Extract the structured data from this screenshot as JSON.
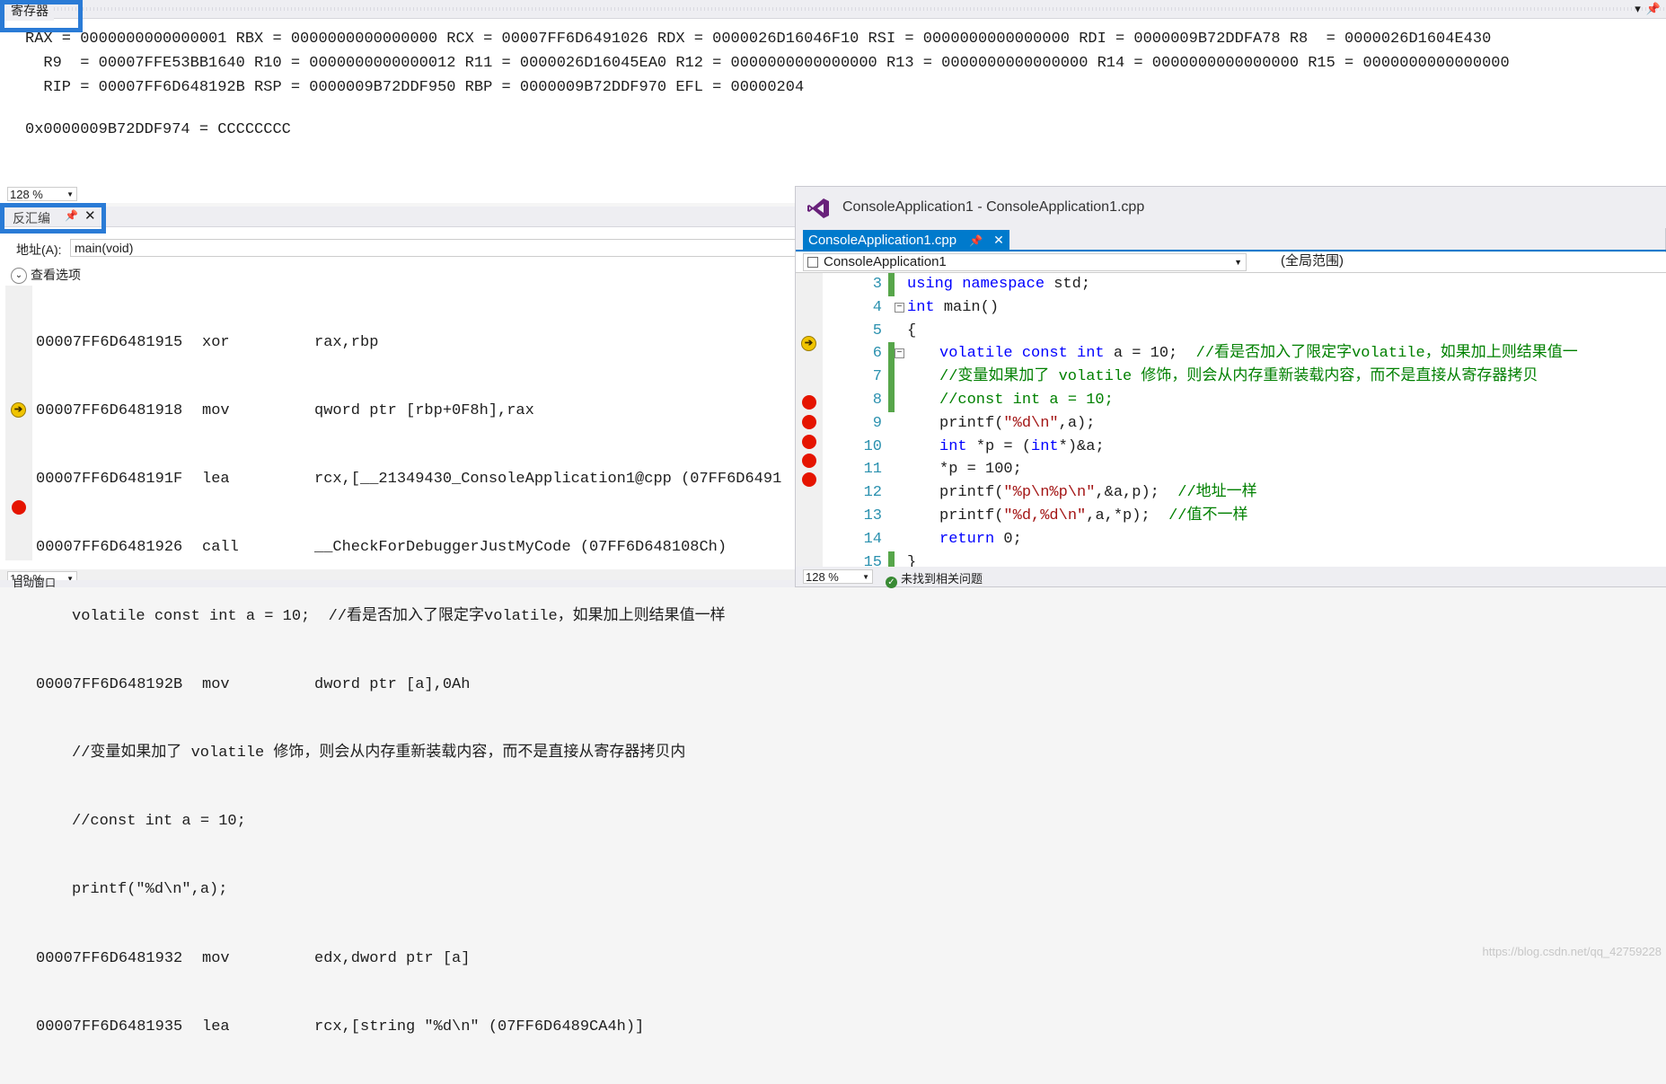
{
  "registers": {
    "title": "寄存器",
    "line1": "RAX = 0000000000000001 RBX = 0000000000000000 RCX = 00007FF6D6491026 RDX = 0000026D16046F10 RSI = 0000000000000000 RDI = 0000009B72DDFA78 R8  = 0000026D1604E430",
    "line2": "  R9  = 00007FFE53BB1640 R10 = 0000000000000012 R11 = 0000026D16045EA0 R12 = 0000000000000000 R13 = 0000000000000000 R14 = 0000000000000000 R15 = 0000000000000000",
    "line3": "  RIP = 00007FF6D648192B RSP = 0000009B72DDF950 RBP = 0000009B72DDF970 EFL = 00000204",
    "line4": "",
    "line5": "0x0000009B72DDF974 = CCCCCCCC",
    "zoom": "128 %"
  },
  "disassembly": {
    "title": "反汇编",
    "address_label": "地址(A):",
    "address_value": "main(void)",
    "view_options": "查看选项",
    "zoom": "128 %",
    "lines": [
      {
        "addr": "00007FF6D6481915",
        "op": "xor",
        "args": "rax,rbp"
      },
      {
        "addr": "00007FF6D6481918",
        "op": "mov",
        "args": "qword ptr [rbp+0F8h],rax"
      },
      {
        "addr": "00007FF6D648191F",
        "op": "lea",
        "args": "rcx,[__21349430_ConsoleApplication1@cpp (07FF6D6491"
      },
      {
        "addr": "00007FF6D6481926",
        "op": "call",
        "args": "__CheckForDebuggerJustMyCode (07FF6D648108Ch)"
      },
      {
        "src": "volatile const int a = 10;  //看是否加入了限定字volatile，如果加上则结果值一样"
      },
      {
        "addr": "00007FF6D648192B",
        "op": "mov",
        "args": "dword ptr [a],0Ah"
      },
      {
        "src": "//变量如果加了 volatile 修饰，则会从内存重新装载内容，而不是直接从寄存器拷贝内"
      },
      {
        "src": "//const int a = 10;"
      },
      {
        "src": "printf(\"%d\\n\",a);"
      },
      {
        "addr": "00007FF6D6481932",
        "op": "mov",
        "args": "edx,dword ptr [a]"
      },
      {
        "addr": "00007FF6D6481935",
        "op": "lea",
        "args": "rcx,[string \"%d\\n\" (07FF6D6489CA4h)]"
      }
    ],
    "bottom_label": "自动窗口"
  },
  "editor": {
    "window_title": "ConsoleApplication1 - ConsoleApplication1.cpp",
    "tab_label": "ConsoleApplication1.cpp",
    "scope": "ConsoleApplication1",
    "member": "(全局范围)",
    "zoom": "128 %",
    "status": "未找到相关问题",
    "watermark": "https://blog.csdn.net/qq_42759228",
    "lines": [
      {
        "n": "3",
        "text": "using namespace std;"
      },
      {
        "n": "4",
        "text": "int main()"
      },
      {
        "n": "5",
        "text": "{"
      },
      {
        "n": "6",
        "text": "volatile const int a = 10;  //看是否加入了限定字volatile，如果加上则结果值一"
      },
      {
        "n": "7",
        "text": "//变量如果加了 volatile 修饰，则会从内存重新装载内容，而不是直接从寄存器拷贝"
      },
      {
        "n": "8",
        "text": "//const int a = 10;"
      },
      {
        "n": "9",
        "text": "printf(\"%d\\n\",a);"
      },
      {
        "n": "10",
        "text": "int *p = (int*)&a;"
      },
      {
        "n": "11",
        "text": "*p = 100;"
      },
      {
        "n": "12",
        "text": "printf(\"%p\\n%p\\n\",&a,p);  //地址一样"
      },
      {
        "n": "13",
        "text": "printf(\"%d,%d\\n\",a,*p);  //值不一样"
      },
      {
        "n": "14",
        "text": "return 0;"
      },
      {
        "n": "15",
        "text": "}"
      }
    ]
  }
}
